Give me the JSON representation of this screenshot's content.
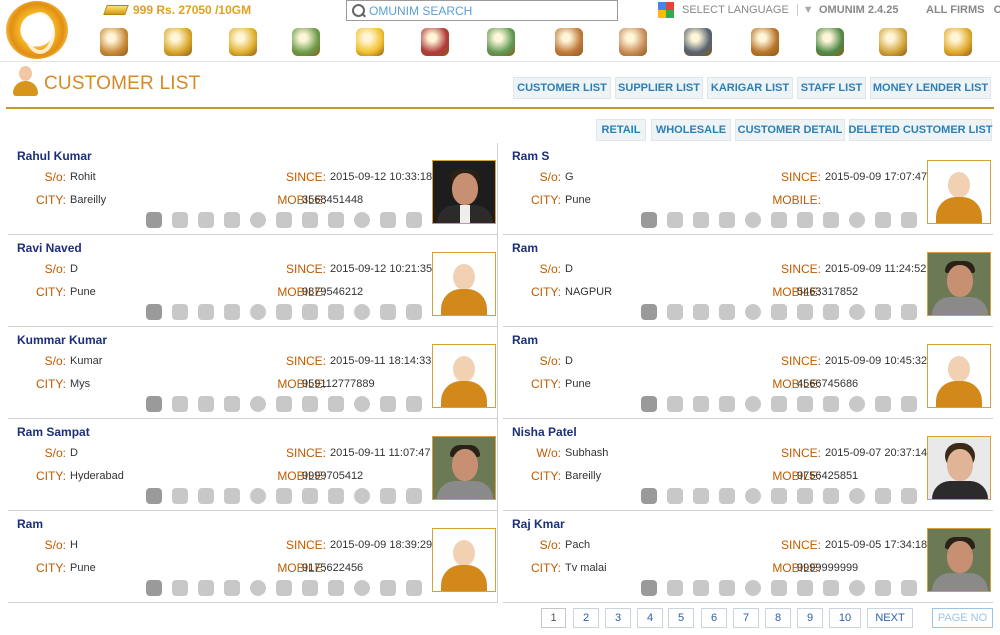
{
  "header": {
    "gold_rate": "999 Rs. 27050 /10GM",
    "search_placeholder": "OMUNIM SEARCH",
    "language_label": "SELECT LANGUAGE",
    "language_dropdown": "▼",
    "version": "OMUNIM 2.4.25",
    "firms": "ALL FIRMS",
    "firms_extra": "OM",
    "nav_icons": [
      "home-icon",
      "add-money-icon",
      "coins-icon",
      "hand-money-icon",
      "new-icon",
      "hammer-icon",
      "money-bag-icon",
      "user-icon",
      "add-user-icon",
      "binoculars-icon",
      "sack-icon",
      "cash-stack-icon",
      "hand-coins-icon",
      "coin-chart-icon"
    ]
  },
  "page": {
    "title": "CUSTOMER LIST",
    "tabs": [
      "CUSTOMER LIST",
      "SUPPLIER LIST",
      "KARIGAR LIST",
      "STAFF LIST",
      "MONEY LENDER LIST"
    ],
    "subtabs": [
      "RETAIL",
      "WHOLESALE",
      "CUSTOMER DETAIL",
      "DELETED CUSTOMER LIST"
    ]
  },
  "labels": {
    "since": "SINCE:",
    "mobile": "MOBILE:",
    "city": "CITY:"
  },
  "customers": [
    {
      "name": "Rahul Kumar",
      "rel": "S/o:",
      "rel_name": "Rohit",
      "city": "Bareilly",
      "since": "2015-09-12 10:33:18",
      "mobile": "3568451448",
      "photo": "suit"
    },
    {
      "name": "Ram S",
      "rel": "S/o:",
      "rel_name": "G",
      "city": "Pune",
      "since": "2015-09-09 17:07:47",
      "mobile": "",
      "photo": "default"
    },
    {
      "name": "Ravi Naved",
      "rel": "S/o:",
      "rel_name": "D",
      "city": "Pune",
      "since": "2015-09-12 10:21:35",
      "mobile": "9879546212",
      "photo": "default"
    },
    {
      "name": "Ram",
      "rel": "S/o:",
      "rel_name": "D",
      "city": "NAGPUR",
      "since": "2015-09-09 11:24:52",
      "mobile": "5463317852",
      "photo": "man"
    },
    {
      "name": "Kummar Kumar",
      "rel": "S/o:",
      "rel_name": "Kumar",
      "city": "Mys",
      "since": "2015-09-11 18:14:33",
      "mobile": "959112777889",
      "photo": "default"
    },
    {
      "name": "Ram",
      "rel": "S/o:",
      "rel_name": "D",
      "city": "Pune",
      "since": "2015-09-09 10:45:32",
      "mobile": "4566745686",
      "photo": "default"
    },
    {
      "name": "Ram Sampat",
      "rel": "S/o:",
      "rel_name": "D",
      "city": "Hyderabad",
      "since": "2015-09-11 11:07:47",
      "mobile": "9999705412",
      "photo": "man"
    },
    {
      "name": "Nisha Patel",
      "rel": "W/o:",
      "rel_name": "Subhash",
      "city": "Bareilly",
      "since": "2015-09-07 20:37:14",
      "mobile": "9756425851",
      "photo": "woman"
    },
    {
      "name": "Ram",
      "rel": "S/o:",
      "rel_name": "H",
      "city": "Pune",
      "since": "2015-09-09 18:39:29",
      "mobile": "9175622456",
      "photo": "default"
    },
    {
      "name": "Raj Kmar",
      "rel": "S/o:",
      "rel_name": "Pach",
      "city": "Tv malai",
      "since": "2015-09-05 17:34:18",
      "mobile": "9999999999",
      "photo": "man"
    }
  ],
  "card_actions": [
    "home-icon",
    "user-icon",
    "notes-icon",
    "stack-icon",
    "circle-icon",
    "hammer-icon",
    "chat-icon",
    "pen-icon",
    "alert-icon",
    "balance-icon",
    "bag-icon"
  ],
  "pagination": {
    "pages": [
      "1",
      "2",
      "3",
      "4",
      "5",
      "6",
      "7",
      "8",
      "9",
      "10"
    ],
    "current": "1",
    "next": "NEXT",
    "page_no": "PAGE NO"
  },
  "colors": {
    "accent": "#d48a25",
    "link": "#2b7fb7",
    "name": "#1b2f7a",
    "label": "#c05a00",
    "rule": "#c59a2a"
  }
}
